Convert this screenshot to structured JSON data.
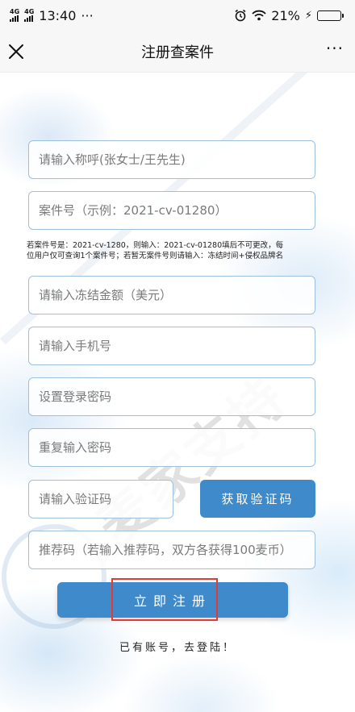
{
  "status_bar": {
    "network_1": "4G",
    "network_2": "4G",
    "time": "13:40",
    "dots": "···",
    "battery": "21%",
    "battery_level": 0.21
  },
  "nav": {
    "title": "注册查案件",
    "more": "···"
  },
  "form": {
    "name_placeholder": "请输入称呼(张女士/王先生)",
    "case_placeholder": "案件号（示例：2021-cv-01280）",
    "hint_line1": "若案件号是：2021-cv-1280，则输入：2021-cv-01280填后不可更改，每",
    "hint_line2": "位用户仅可查询1个案件号；若暂无案件号则请输入：冻结时间+侵权品牌名",
    "amount_placeholder": "请输入冻结金额（美元）",
    "phone_placeholder": "请输入手机号",
    "password_placeholder": "设置登录密码",
    "password_repeat_placeholder": "重复输入密码",
    "code_placeholder": "请输入验证码",
    "get_code_label": "获取验证码",
    "referral_placeholder": "推荐码（若输入推荐码，双方各获得100麦币）",
    "register_label": "立即注册",
    "login_link": "已有账号，去登陆！"
  },
  "watermark": {
    "text": "麦家支持"
  }
}
